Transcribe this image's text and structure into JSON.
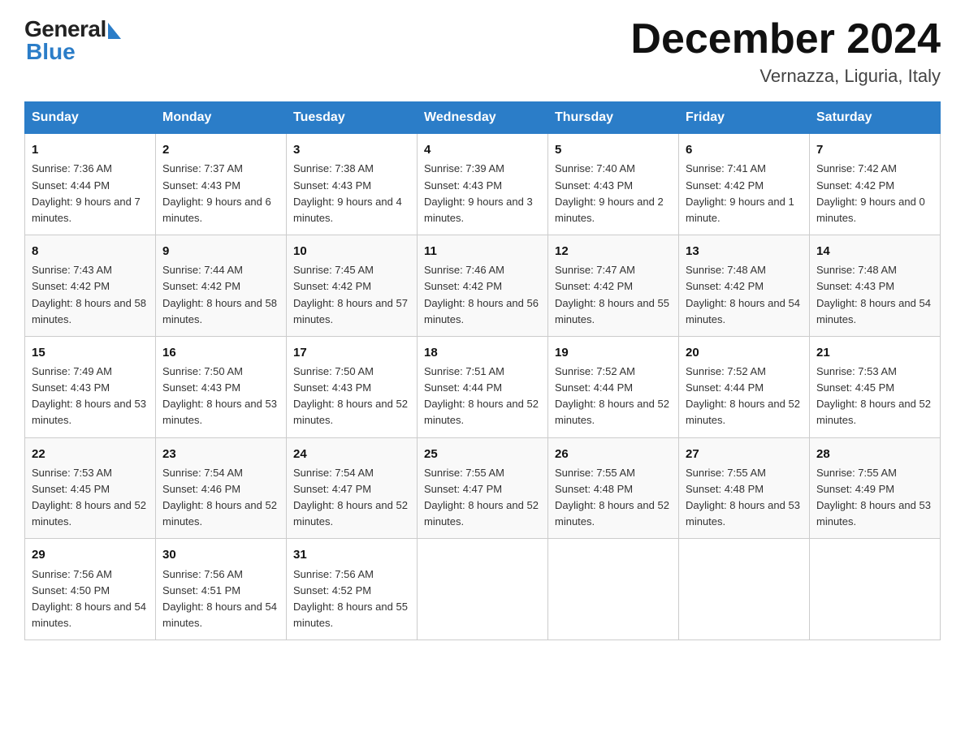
{
  "logo": {
    "general": "General",
    "blue": "Blue"
  },
  "title": "December 2024",
  "subtitle": "Vernazza, Liguria, Italy",
  "weekdays": [
    "Sunday",
    "Monday",
    "Tuesday",
    "Wednesday",
    "Thursday",
    "Friday",
    "Saturday"
  ],
  "weeks": [
    [
      {
        "day": "1",
        "sunrise": "7:36 AM",
        "sunset": "4:44 PM",
        "daylight": "9 hours and 7 minutes."
      },
      {
        "day": "2",
        "sunrise": "7:37 AM",
        "sunset": "4:43 PM",
        "daylight": "9 hours and 6 minutes."
      },
      {
        "day": "3",
        "sunrise": "7:38 AM",
        "sunset": "4:43 PM",
        "daylight": "9 hours and 4 minutes."
      },
      {
        "day": "4",
        "sunrise": "7:39 AM",
        "sunset": "4:43 PM",
        "daylight": "9 hours and 3 minutes."
      },
      {
        "day": "5",
        "sunrise": "7:40 AM",
        "sunset": "4:43 PM",
        "daylight": "9 hours and 2 minutes."
      },
      {
        "day": "6",
        "sunrise": "7:41 AM",
        "sunset": "4:42 PM",
        "daylight": "9 hours and 1 minute."
      },
      {
        "day": "7",
        "sunrise": "7:42 AM",
        "sunset": "4:42 PM",
        "daylight": "9 hours and 0 minutes."
      }
    ],
    [
      {
        "day": "8",
        "sunrise": "7:43 AM",
        "sunset": "4:42 PM",
        "daylight": "8 hours and 58 minutes."
      },
      {
        "day": "9",
        "sunrise": "7:44 AM",
        "sunset": "4:42 PM",
        "daylight": "8 hours and 58 minutes."
      },
      {
        "day": "10",
        "sunrise": "7:45 AM",
        "sunset": "4:42 PM",
        "daylight": "8 hours and 57 minutes."
      },
      {
        "day": "11",
        "sunrise": "7:46 AM",
        "sunset": "4:42 PM",
        "daylight": "8 hours and 56 minutes."
      },
      {
        "day": "12",
        "sunrise": "7:47 AM",
        "sunset": "4:42 PM",
        "daylight": "8 hours and 55 minutes."
      },
      {
        "day": "13",
        "sunrise": "7:48 AM",
        "sunset": "4:42 PM",
        "daylight": "8 hours and 54 minutes."
      },
      {
        "day": "14",
        "sunrise": "7:48 AM",
        "sunset": "4:43 PM",
        "daylight": "8 hours and 54 minutes."
      }
    ],
    [
      {
        "day": "15",
        "sunrise": "7:49 AM",
        "sunset": "4:43 PM",
        "daylight": "8 hours and 53 minutes."
      },
      {
        "day": "16",
        "sunrise": "7:50 AM",
        "sunset": "4:43 PM",
        "daylight": "8 hours and 53 minutes."
      },
      {
        "day": "17",
        "sunrise": "7:50 AM",
        "sunset": "4:43 PM",
        "daylight": "8 hours and 52 minutes."
      },
      {
        "day": "18",
        "sunrise": "7:51 AM",
        "sunset": "4:44 PM",
        "daylight": "8 hours and 52 minutes."
      },
      {
        "day": "19",
        "sunrise": "7:52 AM",
        "sunset": "4:44 PM",
        "daylight": "8 hours and 52 minutes."
      },
      {
        "day": "20",
        "sunrise": "7:52 AM",
        "sunset": "4:44 PM",
        "daylight": "8 hours and 52 minutes."
      },
      {
        "day": "21",
        "sunrise": "7:53 AM",
        "sunset": "4:45 PM",
        "daylight": "8 hours and 52 minutes."
      }
    ],
    [
      {
        "day": "22",
        "sunrise": "7:53 AM",
        "sunset": "4:45 PM",
        "daylight": "8 hours and 52 minutes."
      },
      {
        "day": "23",
        "sunrise": "7:54 AM",
        "sunset": "4:46 PM",
        "daylight": "8 hours and 52 minutes."
      },
      {
        "day": "24",
        "sunrise": "7:54 AM",
        "sunset": "4:47 PM",
        "daylight": "8 hours and 52 minutes."
      },
      {
        "day": "25",
        "sunrise": "7:55 AM",
        "sunset": "4:47 PM",
        "daylight": "8 hours and 52 minutes."
      },
      {
        "day": "26",
        "sunrise": "7:55 AM",
        "sunset": "4:48 PM",
        "daylight": "8 hours and 52 minutes."
      },
      {
        "day": "27",
        "sunrise": "7:55 AM",
        "sunset": "4:48 PM",
        "daylight": "8 hours and 53 minutes."
      },
      {
        "day": "28",
        "sunrise": "7:55 AM",
        "sunset": "4:49 PM",
        "daylight": "8 hours and 53 minutes."
      }
    ],
    [
      {
        "day": "29",
        "sunrise": "7:56 AM",
        "sunset": "4:50 PM",
        "daylight": "8 hours and 54 minutes."
      },
      {
        "day": "30",
        "sunrise": "7:56 AM",
        "sunset": "4:51 PM",
        "daylight": "8 hours and 54 minutes."
      },
      {
        "day": "31",
        "sunrise": "7:56 AM",
        "sunset": "4:52 PM",
        "daylight": "8 hours and 55 minutes."
      },
      null,
      null,
      null,
      null
    ]
  ],
  "labels": {
    "sunrise": "Sunrise:",
    "sunset": "Sunset:",
    "daylight": "Daylight:"
  }
}
